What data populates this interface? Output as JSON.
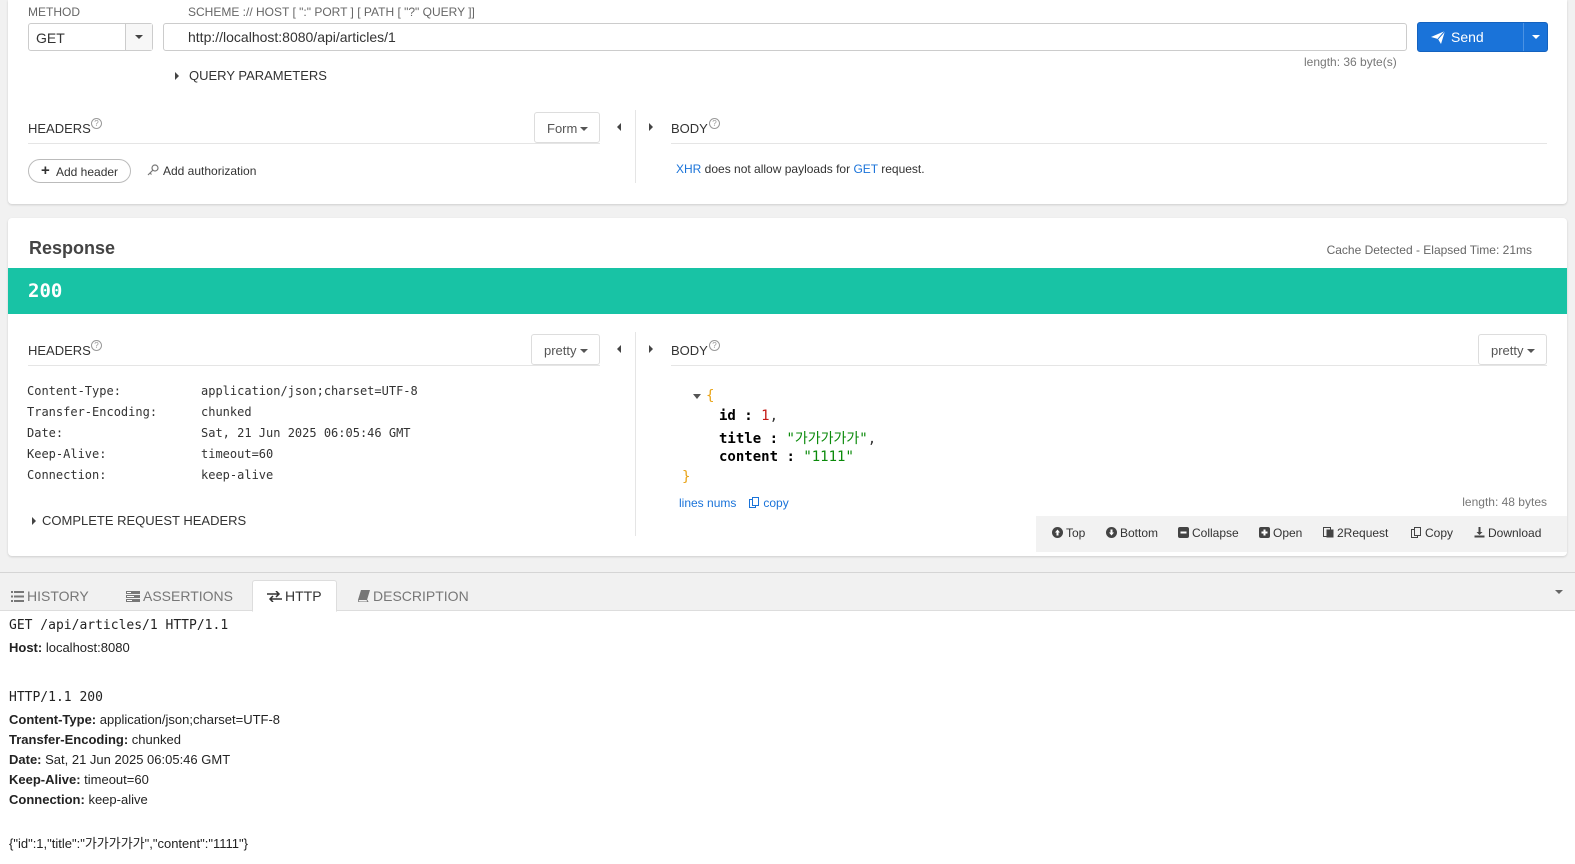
{
  "request": {
    "method_label": "METHOD",
    "method_value": "GET",
    "url_label": "SCHEME :// HOST [ \":\" PORT ] [ PATH [ \"?\" QUERY ]]",
    "url_value": "http://localhost:8080/api/articles/1",
    "send_label": "Send",
    "length": "length: 36 byte(s)",
    "query_params_label": "QUERY PARAMETERS",
    "headers_label": "HEADERS",
    "headers_mode": "Form",
    "body_label": "BODY",
    "add_header_label": "Add header",
    "add_auth_label": "Add authorization",
    "body_note": {
      "xhr": "XHR",
      "middle": " does not allow payloads for ",
      "get": "GET",
      "end": " request."
    }
  },
  "response": {
    "title": "Response",
    "cache_info": "Cache Detected - Elapsed Time: 21ms",
    "status_code": "200",
    "status_color": "#18c3a5",
    "headers_label": "HEADERS",
    "headers_mode": "pretty",
    "body_label": "BODY",
    "body_mode": "pretty",
    "headers": [
      {
        "key": "Content-Type:",
        "value": "application/json;charset=UTF-8"
      },
      {
        "key": "Transfer-Encoding:",
        "value": "chunked"
      },
      {
        "key": "Date:",
        "value": "Sat, 21 Jun 2025 06:05:46 GMT"
      },
      {
        "key": "Keep-Alive:",
        "value": "timeout=60"
      },
      {
        "key": "Connection:",
        "value": "keep-alive"
      }
    ],
    "complete_headers_label": "COMPLETE REQUEST HEADERS",
    "body_json": {
      "open": "{",
      "close": "}",
      "id_key": "id",
      "id_value": "1",
      "title_key": "title",
      "title_value": "\"가가가가가\"",
      "content_key": "content",
      "content_value": "\"1111\""
    },
    "lines_nums_label": "lines nums",
    "copy_label": "copy",
    "length": "length: 48 bytes",
    "toolbar": {
      "top": "Top",
      "bottom": "Bottom",
      "collapse": "Collapse",
      "open": "Open",
      "to_request": "2Request",
      "copy": "Copy",
      "download": "Download"
    }
  },
  "bottom_tabs": {
    "history": "HISTORY",
    "assertions": "ASSERTIONS",
    "http": "HTTP",
    "description": "DESCRIPTION"
  },
  "http_raw": {
    "request_line": "GET /api/articles/1 HTTP/1.1",
    "host_key": "Host:",
    "host_value": " localhost:8080",
    "status_line": "HTTP/1.1 200",
    "headers": [
      {
        "key": "Content-Type:",
        "value": " application/json;charset=UTF-8"
      },
      {
        "key": "Transfer-Encoding:",
        "value": " chunked"
      },
      {
        "key": "Date:",
        "value": " Sat, 21 Jun 2025 06:05:46 GMT"
      },
      {
        "key": "Keep-Alive:",
        "value": " timeout=60"
      },
      {
        "key": "Connection:",
        "value": " keep-alive"
      }
    ],
    "body": "{\"id\":1,\"title\":\"가가가가가\",\"content\":\"1111\"}"
  },
  "colors": {
    "accent": "#1a73d9",
    "status_ok": "#18c3a5"
  }
}
